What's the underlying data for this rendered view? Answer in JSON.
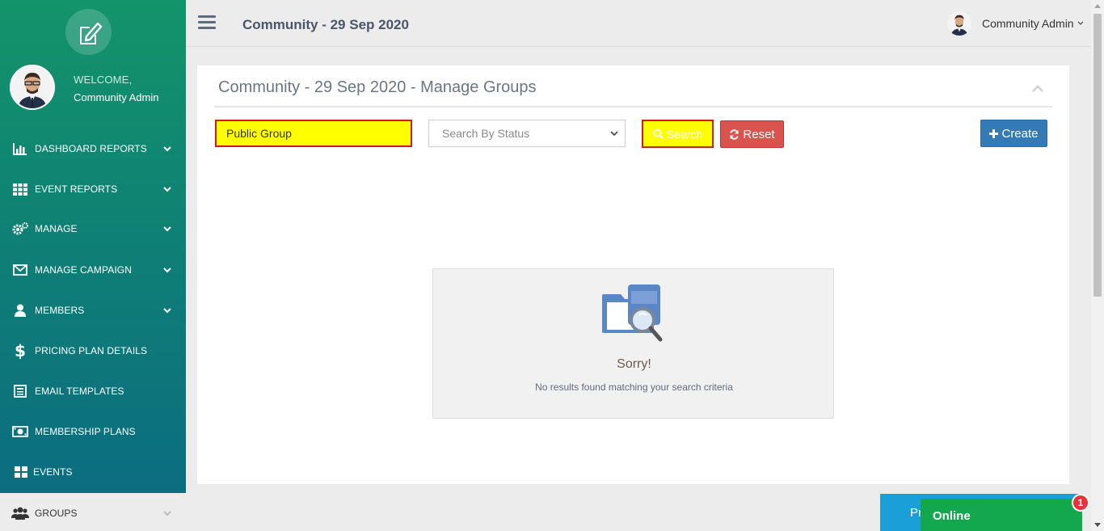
{
  "sidebar": {
    "welcome": "WELCOME,",
    "user_name": "Community Admin",
    "items": [
      {
        "label": "DASHBOARD REPORTS",
        "icon": "bar-chart-icon",
        "has_chevron": true
      },
      {
        "label": "EVENT REPORTS",
        "icon": "grid-icon",
        "has_chevron": true
      },
      {
        "label": "MANAGE",
        "icon": "gears-icon",
        "has_chevron": true
      },
      {
        "label": "MANAGE CAMPAIGN",
        "icon": "envelope-icon",
        "has_chevron": true
      },
      {
        "label": "MEMBERS",
        "icon": "user-icon",
        "has_chevron": true
      },
      {
        "label": "PRICING PLAN DETAILS",
        "icon": "dollar-icon",
        "has_chevron": false
      },
      {
        "label": "EMAIL TEMPLATES",
        "icon": "template-icon",
        "has_chevron": false
      },
      {
        "label": "MEMBERSHIP PLANS",
        "icon": "money-icon",
        "has_chevron": false
      },
      {
        "label": "EVENTS",
        "icon": "tiles-icon",
        "has_chevron": false
      },
      {
        "label": "GROUPS",
        "icon": "users-icon",
        "has_chevron": true,
        "active": true
      }
    ]
  },
  "header": {
    "title": "Community - 29 Sep 2020",
    "user_name": "Community Admin"
  },
  "panel": {
    "title": "Community - 29 Sep 2020 - Manage Groups",
    "search_value": "Public Group",
    "status_placeholder": "Search By Status",
    "search_label": "Search",
    "reset_label": "Reset",
    "create_label": "Create"
  },
  "empty_state": {
    "title": "Sorry!",
    "message": "No results found matching your search criteria"
  },
  "widgets": {
    "blue_tab_text": "Pr",
    "online_label": "Online",
    "badge_count": "1"
  },
  "colors": {
    "sidebar_top": "#13946a",
    "sidebar_bottom": "#0b6a82",
    "highlight_yellow": "#ffff00",
    "highlight_border": "#d11a1a",
    "reset": "#d9534f",
    "create": "#337ab7",
    "online": "#13a84d"
  }
}
